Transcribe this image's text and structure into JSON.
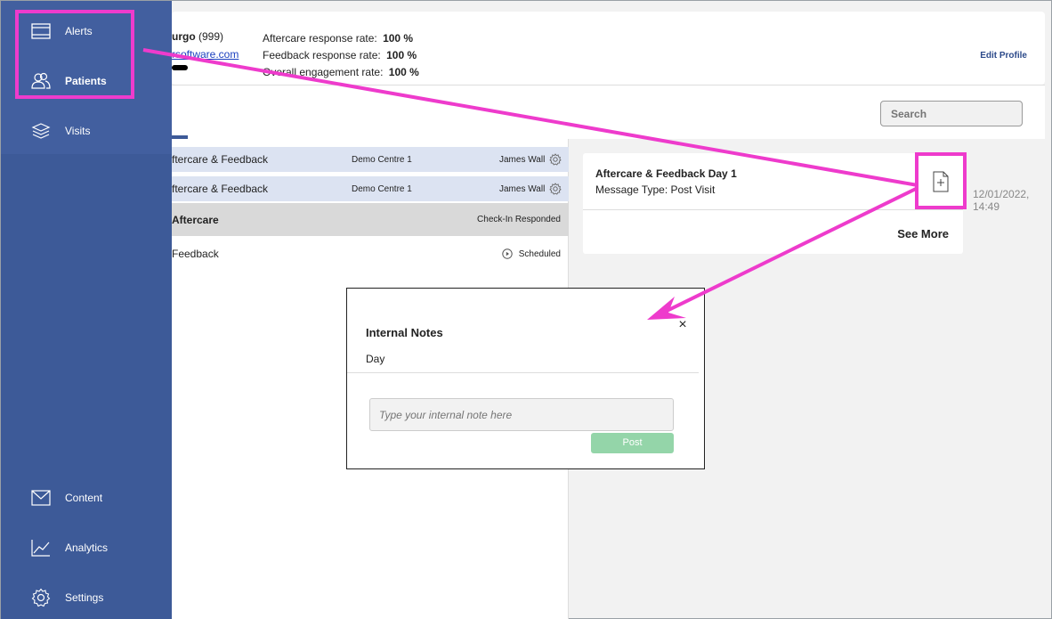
{
  "sidebar": {
    "items": [
      {
        "label": "Alerts",
        "icon": "alerts-icon"
      },
      {
        "label": "Patients",
        "icon": "patients-icon"
      },
      {
        "label": "Visits",
        "icon": "visits-icon"
      },
      {
        "label": "Content",
        "icon": "mail-icon"
      },
      {
        "label": "Analytics",
        "icon": "chart-icon"
      },
      {
        "label": "Settings",
        "icon": "gear-icon"
      }
    ]
  },
  "header": {
    "patient_name": "urgo",
    "patient_id": "(999)",
    "patient_email": "rsoftware.com",
    "stats": [
      {
        "label": "Aftercare response rate:",
        "value": "100 %"
      },
      {
        "label": "Feedback response rate:",
        "value": "100 %"
      },
      {
        "label": "Overall engagement rate:",
        "value": "100 %"
      }
    ],
    "edit_profile": "Edit Profile"
  },
  "toolbar": {
    "search_placeholder": "Search"
  },
  "list": {
    "rows": [
      {
        "title": "ftercare & Feedback",
        "centre": "Demo Centre 1",
        "owner": "James Wall"
      },
      {
        "title": "ftercare & Feedback",
        "centre": "Demo Centre 1",
        "owner": "James Wall"
      },
      {
        "title": "Aftercare",
        "status": "Check-In Responded"
      },
      {
        "title": "Feedback",
        "status": "Scheduled"
      }
    ]
  },
  "detail": {
    "title": "Aftercare & Feedback Day 1",
    "message_type": "Message Type: Post Visit",
    "see_more": "See More",
    "date": "12/01/2022,",
    "time": "14:49"
  },
  "modal": {
    "title": "Internal Notes",
    "subtitle": "Day",
    "close": "×",
    "note_placeholder": "Type your internal note here",
    "post_label": "Post"
  },
  "colors": {
    "sidebar": "#3d5a98",
    "annotation": "#ee3bcc",
    "post_button": "#94d5a9",
    "selected_row": "#dce3f2"
  }
}
